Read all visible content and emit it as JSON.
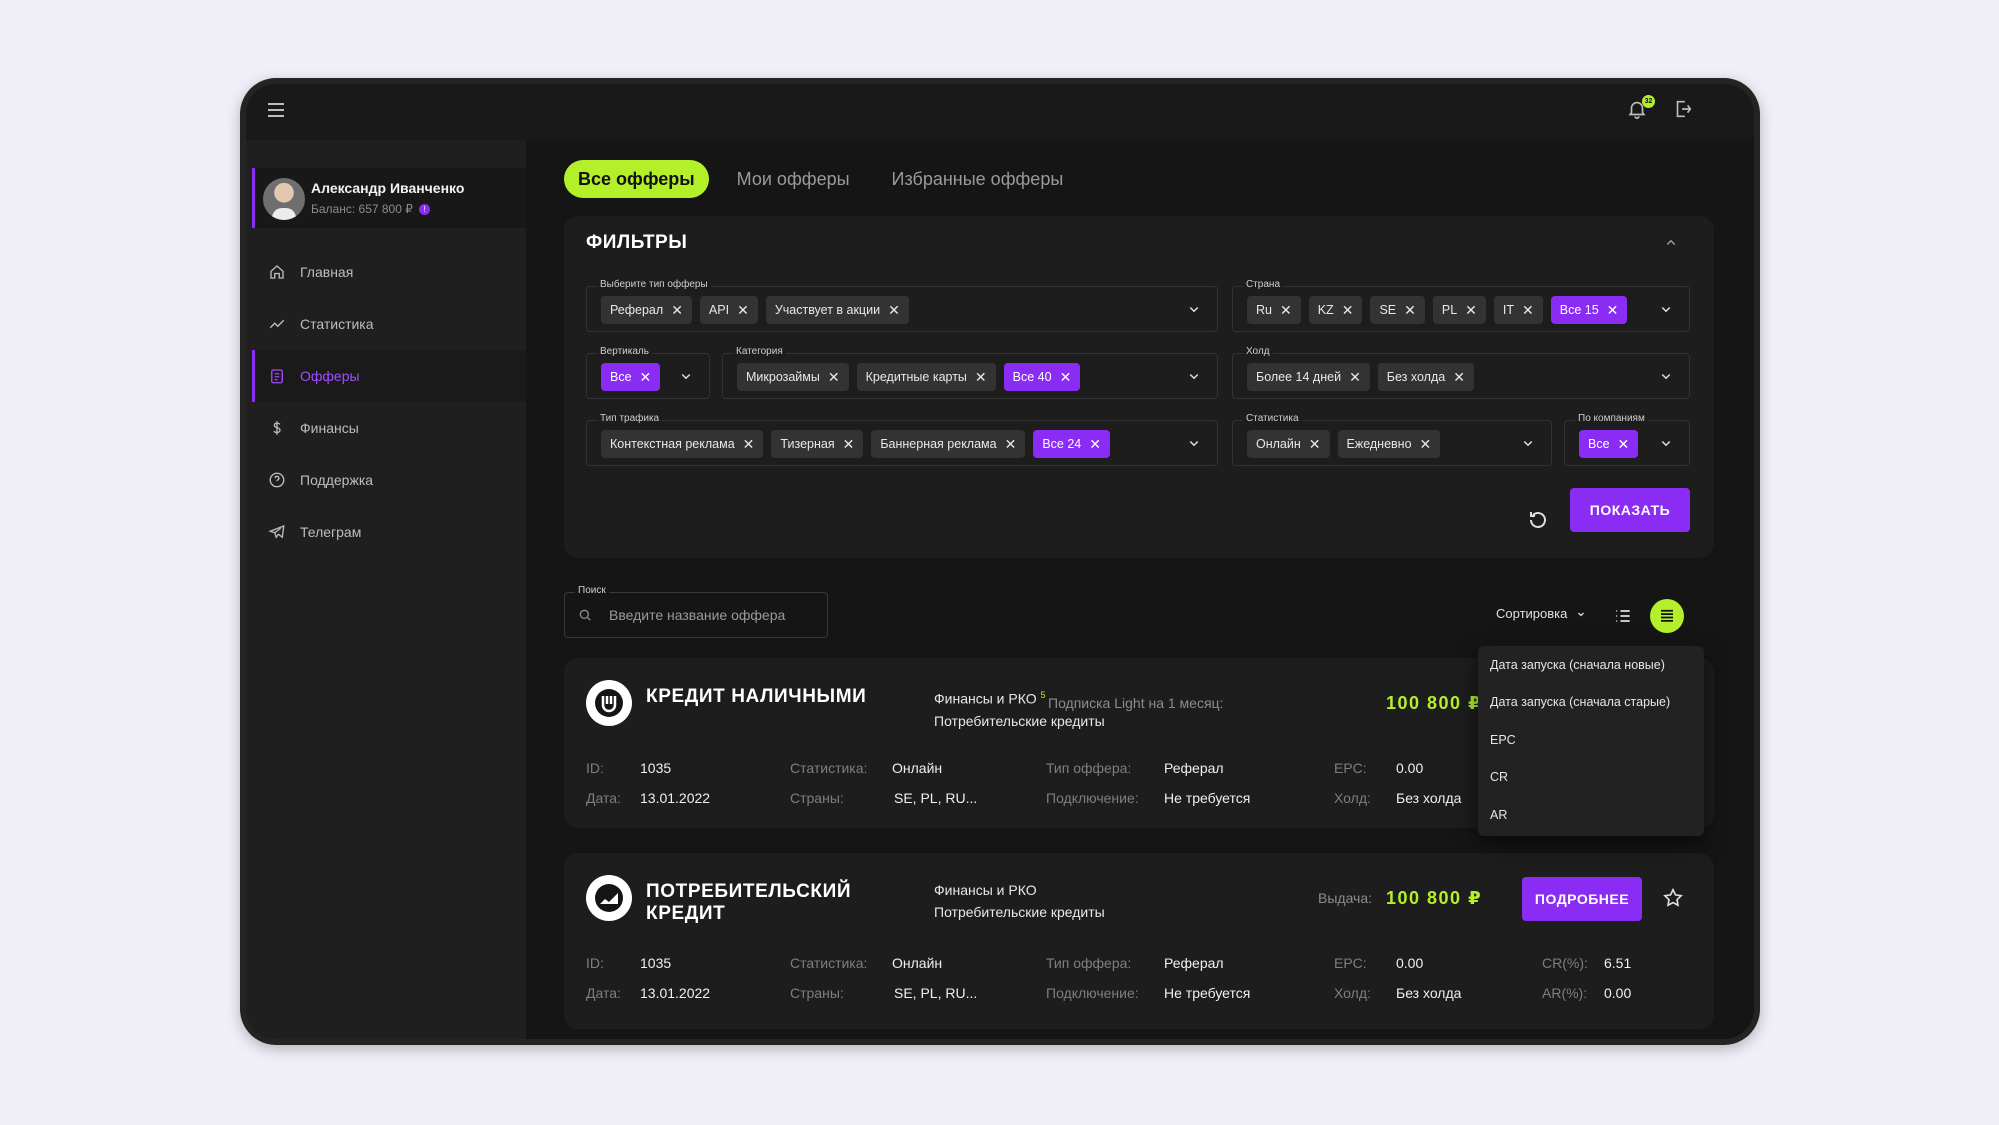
{
  "user": {
    "name": "Александр Иванченко",
    "balance": "Баланс: 657 800 ₽",
    "info_badge": "!"
  },
  "notifications": {
    "count": "32"
  },
  "nav": {
    "items": [
      "Главная",
      "Статистика",
      "Офферы",
      "Финансы",
      "Поддержка",
      "Телеграм"
    ],
    "active": "Офферы"
  },
  "tabs": [
    "Все офферы",
    "Мои офферы",
    "Избранные офферы"
  ],
  "filters": {
    "title": "ФИЛЬТРЫ",
    "offer_type": {
      "label": "Выберите тип офферы",
      "chips": [
        "Реферал",
        "API",
        "Участвует в акции"
      ]
    },
    "country": {
      "label": "Страна",
      "chips": [
        "Ru",
        "KZ",
        "SE",
        "PL",
        "IT"
      ],
      "all": "Все 15"
    },
    "vertical": {
      "label": "Вертикаль",
      "all": "Все"
    },
    "category": {
      "label": "Категория",
      "chips": [
        "Микрозаймы",
        "Кредитные карты"
      ],
      "all": "Все 40"
    },
    "hold": {
      "label": "Холд",
      "chips": [
        "Более 14 дней",
        "Без холда"
      ]
    },
    "traffic": {
      "label": "Тип трафика",
      "chips": [
        "Контекстная реклама",
        "Тизерная",
        "Баннерная реклама"
      ],
      "all": "Все 24"
    },
    "stats": {
      "label": "Статистика",
      "chips": [
        "Онлайн",
        "Ежедневно"
      ]
    },
    "companies": {
      "label": "По компаниям",
      "all": "Все"
    },
    "show_button": "ПОКАЗАТЬ"
  },
  "search": {
    "label": "Поиск",
    "placeholder": "Введите название оффера"
  },
  "sort": {
    "label": "Сортировка",
    "options": [
      "Дата запуска (сначала новые)",
      "Дата запуска (сначала старые)",
      "EPC",
      "CR",
      "AR"
    ]
  },
  "offers": [
    {
      "title": "КРЕДИТ НАЛИЧНЫМИ",
      "category": "Финансы и РКО",
      "category_badge": "5",
      "subcategory": "Потребительские кредиты",
      "price_label": "Подписка Light на 1 месяц:",
      "price": "100 800 ₽",
      "id_label": "ID:",
      "id": "1035",
      "date_label": "Дата:",
      "date": "13.01.2022",
      "stats_label": "Статистика:",
      "stats": "Онлайн",
      "countries_label": "Страны:",
      "countries": "SE, PL, RU...",
      "type_label": "Тип оффера:",
      "type": "Реферал",
      "connect_label": "Подключение:",
      "connect": "Не требуется",
      "epc_label": "EPC:",
      "epc": "0.00",
      "hold_label": "Холд:",
      "hold": "Без холда"
    },
    {
      "title_line1": "ПОТРЕБИТЕЛЬСКИЙ",
      "title_line2": "КРЕДИТ",
      "category": "Финансы и РКО",
      "subcategory": "Потребительские кредиты",
      "price_label": "Выдача:",
      "price": "100 800 ₽",
      "more_button": "ПОДРОБНЕЕ",
      "id_label": "ID:",
      "id": "1035",
      "date_label": "Дата:",
      "date": "13.01.2022",
      "stats_label": "Статистика:",
      "stats": "Онлайн",
      "countries_label": "Страны:",
      "countries": "SE, PL, RU...",
      "type_label": "Тип оффера:",
      "type": "Реферал",
      "connect_label": "Подключение:",
      "connect": "Не требуется",
      "epc_label": "EPC:",
      "epc": "0.00",
      "hold_label": "Холд:",
      "hold": "Без холда",
      "cr_label": "CR(%):",
      "cr": "6.51",
      "ar_label": "AR(%):",
      "ar": "0.00"
    }
  ],
  "colors": {
    "accent_purple": "#8b2cf5",
    "accent_green": "#b4f02a",
    "bg_dark": "#151515",
    "card": "#1d1d1d"
  }
}
